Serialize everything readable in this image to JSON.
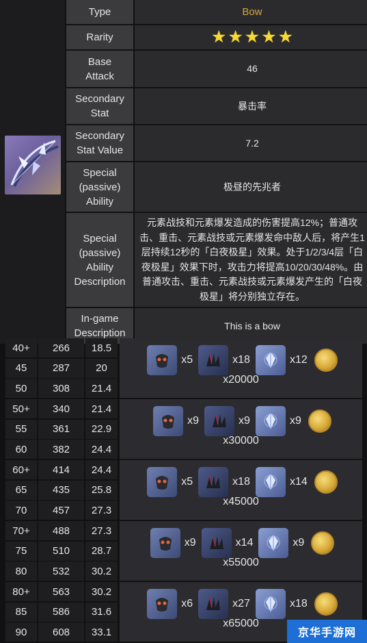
{
  "info": {
    "type_label": "Type",
    "type_value": "Bow",
    "rarity_label": "Rarity",
    "rarity_stars": 5,
    "base_attack_label": "Base\nAttack",
    "base_attack_value": "46",
    "secondary_stat_label": "Secondary\nStat",
    "secondary_stat_value": "暴击率",
    "secondary_stat_value_label": "Secondary\nStat Value",
    "secondary_stat_value_value": "7.2",
    "ability_label": "Special\n(passive)\nAbility",
    "ability_value": "极昼的先兆者",
    "ability_desc_label": "Special\n(passive)\nAbility\nDescription",
    "ability_desc_value": "元素战技和元素爆发造成的伤害提高12%；普通攻击、重击、元素战技或元素爆发命中敌人后，将产生1层持续12秒的「白夜极星」效果。处于1/2/3/4层「白夜极星」效果下时，攻击力将提高10/20/30/48%。由普通攻击、重击、元素战技或元素爆发产生的「白夜极星」将分别独立存在。",
    "ingame_desc_label": "In-game\nDescription",
    "ingame_desc_value": "This is a bow"
  },
  "colors": {
    "gold": "#d4a83c",
    "star": "#f6d836",
    "label_bg": "#3b3b3e",
    "value_bg": "#2b2b2e"
  },
  "ascension": [
    {
      "rows": [
        [
          "40+",
          "266",
          "18.5"
        ],
        [
          "45",
          "287",
          "20"
        ],
        [
          "50",
          "308",
          "21.4"
        ]
      ],
      "materials": [
        {
          "icon": "mask-icon",
          "qty": "x5"
        },
        {
          "icon": "claw-icon",
          "qty": "x18"
        },
        {
          "icon": "crystal-icon",
          "qty": "x12"
        }
      ],
      "mora": "x20000"
    },
    {
      "rows": [
        [
          "50+",
          "340",
          "21.4"
        ],
        [
          "55",
          "361",
          "22.9"
        ],
        [
          "60",
          "382",
          "24.4"
        ]
      ],
      "materials": [
        {
          "icon": "mask-icon",
          "qty": "x9"
        },
        {
          "icon": "claw-icon",
          "qty": "x9"
        },
        {
          "icon": "crystal-icon",
          "qty": "x9"
        }
      ],
      "mora": "x30000"
    },
    {
      "rows": [
        [
          "60+",
          "414",
          "24.4"
        ],
        [
          "65",
          "435",
          "25.8"
        ],
        [
          "70",
          "457",
          "27.3"
        ]
      ],
      "materials": [
        {
          "icon": "mask-icon",
          "qty": "x5"
        },
        {
          "icon": "claw-icon",
          "qty": "x18"
        },
        {
          "icon": "crystal-icon",
          "qty": "x14"
        }
      ],
      "mora": "x45000"
    },
    {
      "rows": [
        [
          "70+",
          "488",
          "27.3"
        ],
        [
          "75",
          "510",
          "28.7"
        ],
        [
          "80",
          "532",
          "30.2"
        ]
      ],
      "materials": [
        {
          "icon": "mask-icon",
          "qty": "x9"
        },
        {
          "icon": "claw-icon",
          "qty": "x14"
        },
        {
          "icon": "crystal-icon",
          "qty": "x9"
        }
      ],
      "mora": "x55000"
    },
    {
      "rows": [
        [
          "80+",
          "563",
          "30.2"
        ],
        [
          "85",
          "586",
          "31.6"
        ],
        [
          "90",
          "608",
          "33.1"
        ]
      ],
      "materials": [
        {
          "icon": "mask-icon",
          "qty": "x6"
        },
        {
          "icon": "claw-icon",
          "qty": "x27"
        },
        {
          "icon": "crystal-icon",
          "qty": "x18"
        }
      ],
      "mora": "x65000"
    }
  ],
  "watermark": "京华手游网"
}
